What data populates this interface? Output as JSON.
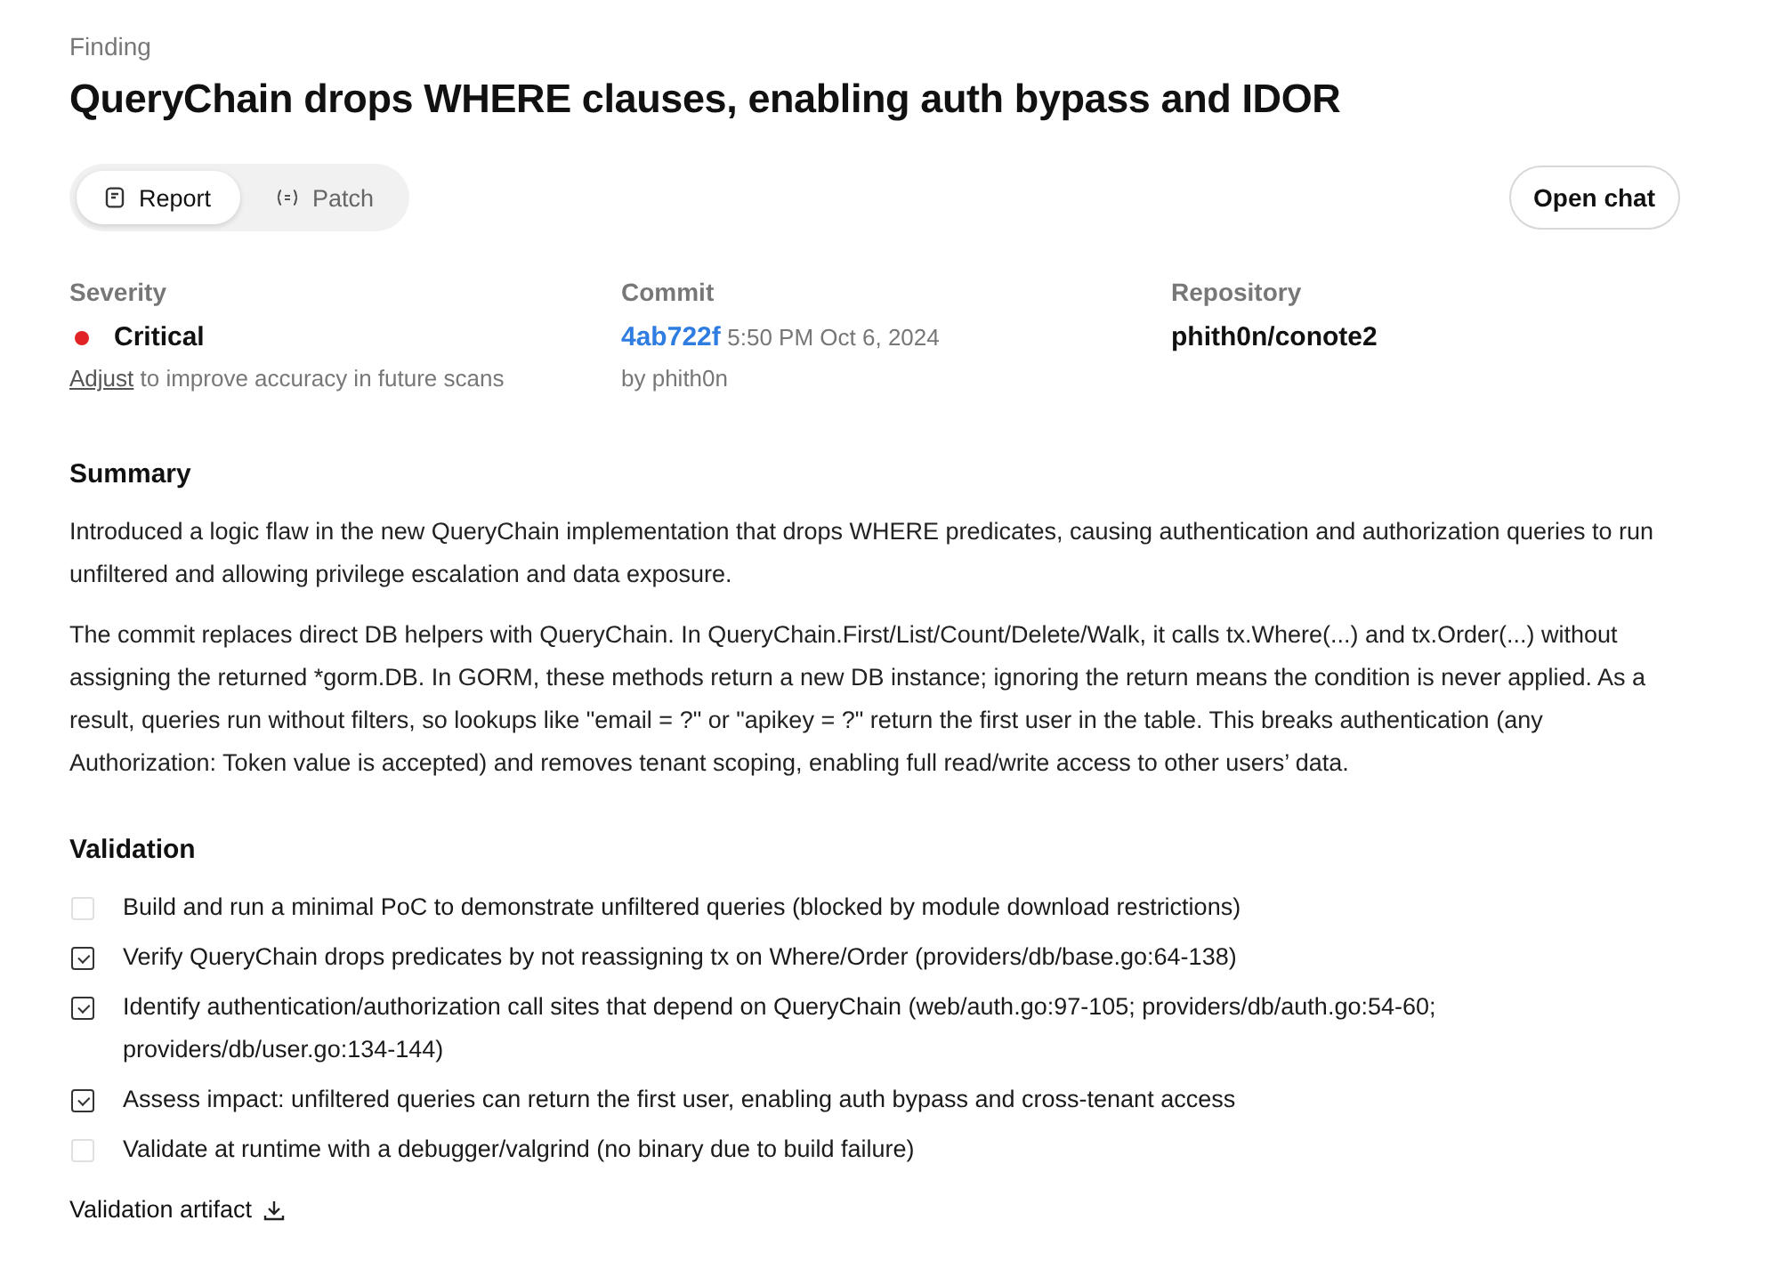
{
  "header": {
    "eyebrow": "Finding",
    "title": "QueryChain drops WHERE clauses, enabling auth bypass and IDOR"
  },
  "tabs": [
    {
      "label": "Report",
      "selected": true
    },
    {
      "label": "Patch",
      "selected": false
    }
  ],
  "open_chat": "Open chat",
  "meta": {
    "severity": {
      "label": "Severity",
      "value": "Critical",
      "color": "#e02424",
      "adjust_link": "Adjust",
      "adjust_hint": " to improve accuracy in future scans"
    },
    "commit": {
      "label": "Commit",
      "hash": "4ab722f",
      "time": "5:50 PM Oct 6, 2024",
      "author": "by phith0n"
    },
    "repository": {
      "label": "Repository",
      "value": "phith0n/conote2"
    }
  },
  "summary": {
    "heading": "Summary",
    "paragraphs": [
      "Introduced a logic flaw in the new QueryChain implementation that drops WHERE predicates, causing authentication and authorization queries to run unfiltered and allowing privilege escalation and data exposure.",
      "The commit replaces direct DB helpers with QueryChain. In QueryChain.First/List/Count/Delete/Walk, it calls tx.Where(...) and tx.Order(...) without assigning the returned *gorm.DB. In GORM, these methods return a new DB instance; ignoring the return means the condition is never applied. As a result, queries run without filters, so lookups like \"email = ?\" or \"apikey = ?\" return the first user in the table. This breaks authentication (any Authorization: Token value is accepted) and removes tenant scoping, enabling full read/write access to other users’ data."
    ]
  },
  "validation": {
    "heading": "Validation",
    "items": [
      {
        "text": "Build and run a minimal PoC to demonstrate unfiltered queries (blocked by module download restrictions)",
        "checked": false
      },
      {
        "text": "Verify QueryChain drops predicates by not reassigning tx on Where/Order (providers/db/base.go:64-138)",
        "checked": true
      },
      {
        "text": "Identify authentication/authorization call sites that depend on QueryChain (web/auth.go:97-105; providers/db/auth.go:54-60; providers/db/user.go:134-144)",
        "checked": true
      },
      {
        "text": "Assess impact: unfiltered queries can return the first user, enabling auth bypass and cross-tenant access",
        "checked": true
      },
      {
        "text": "Validate at runtime with a debugger/valgrind (no binary due to build failure)",
        "checked": false
      }
    ],
    "artifact": "Validation artifact"
  }
}
